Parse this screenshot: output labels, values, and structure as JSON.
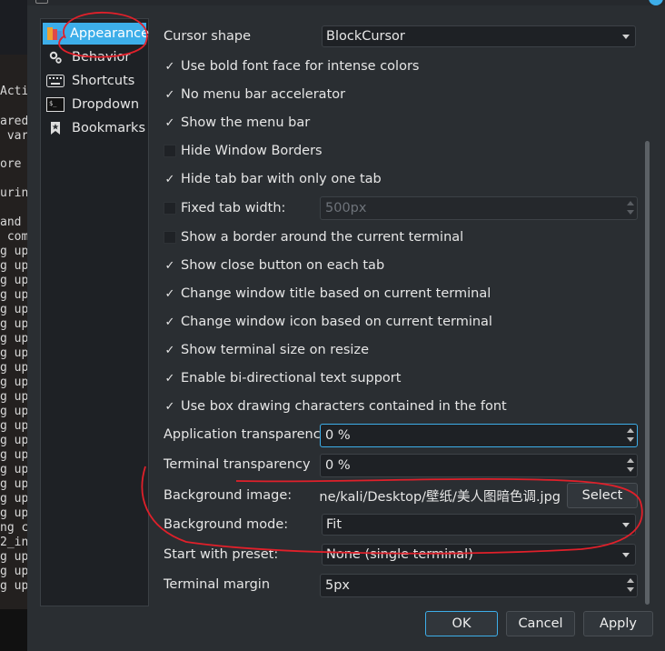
{
  "terminal": {
    "lines": [
      {
        "t": "Actic"
      },
      {
        "t": "ared"
      },
      {
        "t": " var"
      },
      {
        "t": "ore "
      },
      {
        "t": "urin"
      },
      {
        "t": "and "
      },
      {
        "t": " com"
      },
      {
        "t": "g up"
      },
      {
        "t": "g up"
      },
      {
        "t": "g up"
      },
      {
        "t": "g up"
      },
      {
        "t": "g up"
      },
      {
        "t": "g up"
      },
      {
        "t": "g up"
      },
      {
        "t": "g up"
      },
      {
        "t": "g up"
      },
      {
        "t": "g up"
      },
      {
        "t": "g up"
      },
      {
        "t": "g up"
      },
      {
        "t": "g up"
      },
      {
        "t": "g up"
      },
      {
        "t": "g up"
      },
      {
        "t": "g up"
      },
      {
        "t": "g up"
      },
      {
        "t": "g up"
      },
      {
        "t": "g up"
      },
      {
        "t": "ng c"
      },
      {
        "t": "2_in"
      },
      {
        "t": "g up"
      },
      {
        "t": "g up"
      },
      {
        "t": "g up"
      }
    ]
  },
  "sidebar": {
    "items": [
      {
        "label": "Appearance",
        "icon": "appearance-icon",
        "active": true
      },
      {
        "label": "Behavior",
        "icon": "gears-icon"
      },
      {
        "label": "Shortcuts",
        "icon": "keyboard-icon"
      },
      {
        "label": "Dropdown",
        "icon": "terminal-icon"
      },
      {
        "label": "Bookmarks",
        "icon": "bookmark-icon"
      }
    ]
  },
  "settings": {
    "cursor_shape_label": "Cursor shape",
    "cursor_shape_value": "BlockCursor",
    "checkboxes": [
      {
        "label": "Use bold font face for intense colors",
        "checked": true
      },
      {
        "label": "No menu bar accelerator",
        "checked": true
      },
      {
        "label": "Show the menu bar",
        "checked": true
      },
      {
        "label": "Hide Window Borders",
        "checked": false
      },
      {
        "label": "Hide tab bar with only one tab",
        "checked": true
      },
      {
        "label": "Fixed tab width:",
        "checked": false
      },
      {
        "label": "Show a border around the current terminal",
        "checked": false
      },
      {
        "label": "Show close button on each tab",
        "checked": true
      },
      {
        "label": "Change window title based on current terminal",
        "checked": true
      },
      {
        "label": "Change window icon based on current terminal",
        "checked": true
      },
      {
        "label": "Show terminal size on resize",
        "checked": true
      },
      {
        "label": "Enable bi-directional text support",
        "checked": true
      },
      {
        "label": "Use box drawing characters contained in the font",
        "checked": true
      }
    ],
    "check_glyph": "✓",
    "fixed_tab_width_value": "500px",
    "app_transparency_label": "Application transparency",
    "app_transparency_value": "0 %",
    "term_transparency_label": "Terminal transparency",
    "term_transparency_value": "0 %",
    "bg_image_label": "Background image:",
    "bg_image_value": "ne/kali/Desktop/壁纸/美人图暗色调.jpg",
    "select_button": "Select",
    "bg_mode_label": "Background mode:",
    "bg_mode_value": "Fit",
    "preset_label": "Start with preset:",
    "preset_value": "None (single terminal)",
    "margin_label": "Terminal margin",
    "margin_value": "5px"
  },
  "buttons": {
    "ok": "OK",
    "cancel": "Cancel",
    "apply": "Apply"
  },
  "colors": {
    "accent": "#3daee9",
    "annotation": "#e0202a"
  }
}
